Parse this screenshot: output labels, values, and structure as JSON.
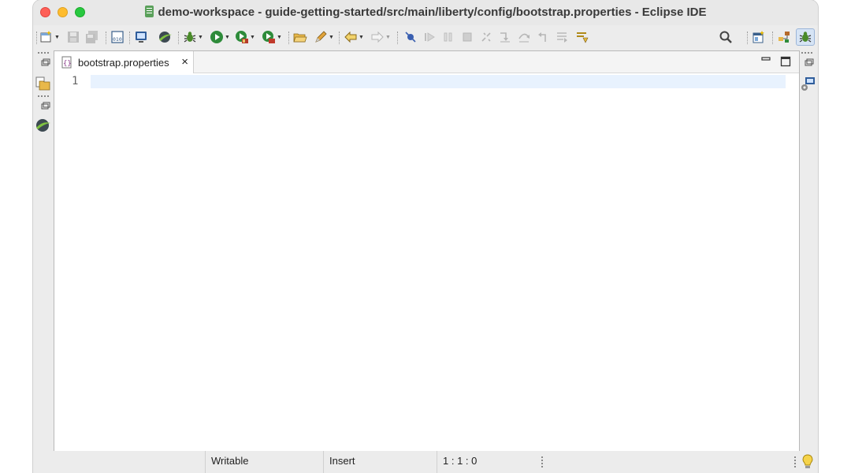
{
  "window": {
    "title": "demo-workspace - guide-getting-started/src/main/liberty/config/bootstrap.properties - Eclipse IDE"
  },
  "toolbar": {
    "buttons": [
      "new-wizard",
      "save",
      "save-all",
      "open-type-binary",
      "open-console",
      "liberty-tools",
      "debug",
      "run",
      "run-coverage",
      "external-tools",
      "open-project",
      "search-annotation",
      "navigate-back",
      "navigate-forward",
      "skip-breakpoints",
      "resume",
      "suspend",
      "terminate",
      "disconnect",
      "step-into",
      "step-over",
      "step-return",
      "drop-to-frame",
      "use-step-filters",
      "search",
      "open-perspective",
      "java-perspective",
      "debug-perspective"
    ]
  },
  "editor": {
    "tab_label": "bootstrap.properties",
    "tab_close": "×",
    "line_numbers": [
      "1"
    ],
    "content": ""
  },
  "statusbar": {
    "mode": "Writable",
    "insert": "Insert",
    "position": "1 : 1 : 0"
  },
  "colors": {
    "current_line": "#e8f2fe",
    "tab_active": "#ffffff",
    "close": "#fe5f57",
    "minimize": "#febc2e",
    "maximize": "#28c840"
  }
}
